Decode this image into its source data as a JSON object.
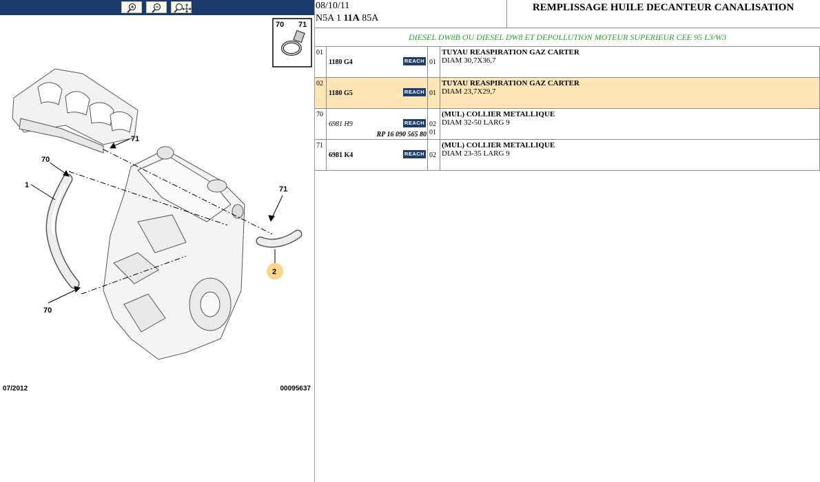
{
  "toolbar": {
    "buttons": [
      {
        "name": "zoom-in"
      },
      {
        "name": "zoom-out"
      },
      {
        "name": "zoom-move"
      }
    ]
  },
  "diagram": {
    "date": "07/2012",
    "ref": "00095637",
    "inset_labels": [
      "70",
      "71"
    ],
    "callouts": {
      "c1": "1",
      "c2": "2",
      "c70a": "70",
      "c70b": "70",
      "c71a": "71",
      "c71b": "71"
    },
    "colors": {
      "highlight": "#fbd58a",
      "line": "#000000"
    }
  },
  "header": {
    "date": "08/10/11",
    "code_prefix": "N5A 1",
    "code_bold": "11A",
    "code_suffix": "85A",
    "title": "REMPLISSAGE HUILE DECANTEUR CANALISATION"
  },
  "subtitle": "DIESEL DW8B OU DIESEL DW8 ET DEPOLLUTION MOTEUR SUPERIEUR CEE 95 L3/W3",
  "reach_label": "REACH",
  "rows": [
    {
      "idx": "01",
      "part": "1180 G4",
      "italic": false,
      "qty": "01",
      "qty2": "",
      "rp": "",
      "name": "TUYAU REASPIRATION GAZ CARTER",
      "spec": "DIAM 30,7X36,7",
      "highlight": false
    },
    {
      "idx": "02",
      "part": "1180 G5",
      "italic": false,
      "qty": "01",
      "qty2": "",
      "rp": "",
      "name": "TUYAU REASPIRATION GAZ CARTER",
      "spec": "DIAM 23,7X29,7",
      "highlight": true
    },
    {
      "idx": "70",
      "part": "6981 H9",
      "italic": true,
      "qty": "02",
      "qty2": "01",
      "rp": "RP 16 090 565 80",
      "name": "(MUL) COLLIER METALLIQUE",
      "spec": "DIAM 32-50 LARG 9",
      "highlight": false
    },
    {
      "idx": "71",
      "part": "6981 K4",
      "italic": false,
      "qty": "02",
      "qty2": "",
      "rp": "",
      "name": "(MUL) COLLIER METALLIQUE",
      "spec": "DIAM 23-35 LARG 9",
      "highlight": false
    }
  ]
}
